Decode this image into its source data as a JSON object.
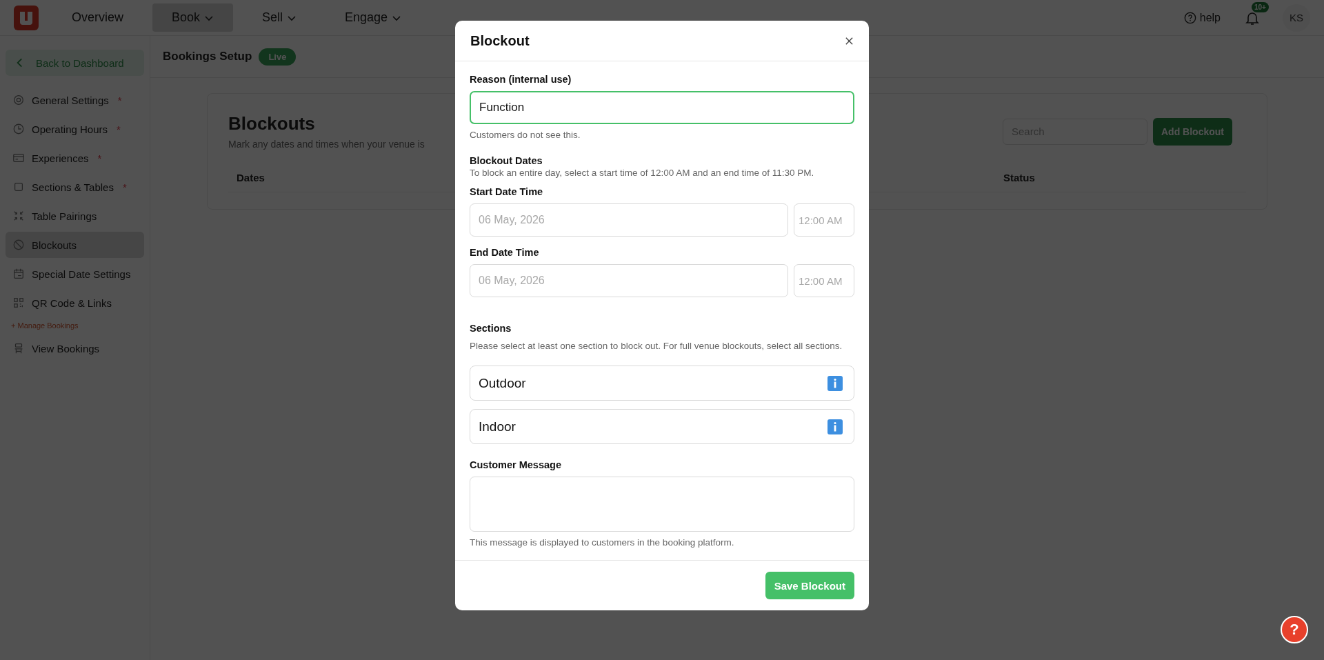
{
  "topbar": {
    "nav": [
      {
        "label": "Overview",
        "selected": false,
        "dropdown": false
      },
      {
        "label": "Book",
        "selected": true,
        "dropdown": true
      },
      {
        "label": "Sell",
        "selected": false,
        "dropdown": true
      },
      {
        "label": "Engage",
        "selected": false,
        "dropdown": true
      }
    ],
    "help": "help",
    "notification_badge": "10+",
    "avatar": "KS"
  },
  "sidebar": {
    "back": "Back to Dashboard",
    "items": [
      {
        "kind": "link",
        "label": "General Settings",
        "mark": "*",
        "selected": false
      },
      {
        "kind": "link",
        "label": "Operating Hours",
        "mark": "*",
        "selected": false
      },
      {
        "kind": "link",
        "label": "Experiences",
        "mark": "*",
        "selected": false
      },
      {
        "kind": "link",
        "label": "Sections & Tables",
        "mark": "*",
        "selected": false
      },
      {
        "kind": "link",
        "label": "Table Pairings",
        "selected": false
      },
      {
        "kind": "link",
        "label": "Blockouts",
        "selected": true
      },
      {
        "kind": "link",
        "label": "Special Date Settings",
        "selected": false
      },
      {
        "kind": "link",
        "label": "QR Code & Links",
        "selected": false
      },
      {
        "kind": "group",
        "label": "+ Manage Bookings"
      },
      {
        "kind": "link",
        "label": "View Bookings",
        "selected": false
      }
    ]
  },
  "header": {
    "title": "Bookings Setup",
    "badge": "Live"
  },
  "page": {
    "title": "Blockouts",
    "subtitle": "Mark any dates and times when your venue is",
    "search": {
      "placeholder": "Search"
    },
    "add_button": "Add Blockout",
    "columns": [
      "Dates",
      "Status"
    ]
  },
  "modal": {
    "title": "Blockout",
    "reason": {
      "label": "Reason (internal use)",
      "value": "Function",
      "focused": true,
      "hint": "Customers do not see this."
    },
    "dates": {
      "title": "Blockout Dates",
      "hint": "To block an entire day, select a start time of 12:00 AM and an end time of 11:30 PM.",
      "fields": [
        {
          "label": "Start Date Time",
          "date_placeholder": "06 May, 2026",
          "time_placeholder": "12:00 AM"
        },
        {
          "label": "End Date Time",
          "date_placeholder": "06 May, 2026",
          "time_placeholder": "12:00 AM"
        }
      ]
    },
    "sections": {
      "title": "Sections",
      "hint": "Please select at least one section to block out. For full venue blockouts, select all sections.",
      "items": [
        "Outdoor",
        "Indoor"
      ]
    },
    "message": {
      "label": "Customer Message",
      "hint": "This message is displayed to customers in the booking platform."
    },
    "save_button": "Save Blockout"
  },
  "help_fab": "?"
}
